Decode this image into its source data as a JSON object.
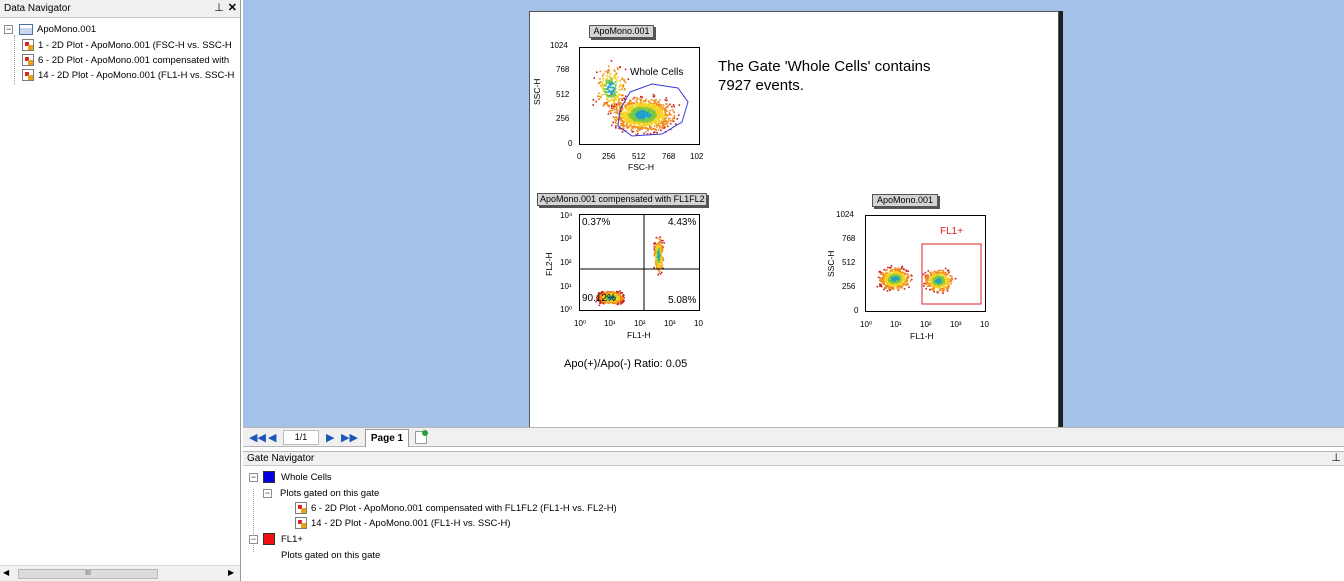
{
  "data_navigator": {
    "title": "Data Navigator",
    "pin_icon": "pin-icon",
    "close_icon": "close-icon",
    "root": {
      "label": "ApoMono.001",
      "expander": "−"
    },
    "items": [
      {
        "label": "1 - 2D Plot - ApoMono.001 (FSC-H vs. SSC-H"
      },
      {
        "label": "6 - 2D Plot - ApoMono.001 compensated with"
      },
      {
        "label": "14 - 2D Plot - ApoMono.001 (FL1-H vs. SSC-H"
      }
    ],
    "scroll_grip": "III"
  },
  "layout_page": {
    "gate_text_line1": "The Gate 'Whole Cells' contains",
    "gate_text_line2": "7927 events.",
    "ratio_text": "Apo(+)/Apo(-) Ratio: 0.05",
    "plot1": {
      "tag": "ApoMono.001",
      "xlabel": "FSC-H",
      "ylabel": "SSC-H",
      "xticks": [
        "0",
        "256",
        "512",
        "768",
        "102"
      ],
      "yticks": [
        "1024",
        "768",
        "512",
        "256",
        "0"
      ],
      "gate_label": "Whole Cells",
      "gate_color": "#3a3ad8"
    },
    "plot2": {
      "tag": "ApoMono.001 compensated with FL1FL2",
      "xlabel": "FL1-H",
      "ylabel": "FL2-H",
      "xticks": [
        "10⁰",
        "10¹",
        "10²",
        "10³",
        "10"
      ],
      "yticks": [
        "10⁴",
        "10³",
        "10²",
        "10¹",
        "10⁰"
      ],
      "quadrants": {
        "ul": "0.37%",
        "ur": "4.43%",
        "ll": "90.12%",
        "lr": "5.08%"
      }
    },
    "plot3": {
      "tag": "ApoMono.001",
      "xlabel": "FL1-H",
      "ylabel": "SSC-H",
      "xticks": [
        "10⁰",
        "10¹",
        "10²",
        "10³",
        "10"
      ],
      "yticks": [
        "1024",
        "768",
        "512",
        "256",
        "0"
      ],
      "gate_label": "FL1+",
      "gate_color": "#e02020"
    }
  },
  "page_nav": {
    "page_value": "1/1",
    "page_tab": "Page 1",
    "first_icon": "first-page-icon",
    "prev_icon": "prev-page-icon",
    "next_icon": "next-page-icon",
    "last_icon": "last-page-icon"
  },
  "gate_navigator": {
    "title": "Gate Navigator",
    "gates": [
      {
        "name": "Whole Cells",
        "color": "#0000e0",
        "sub": "Plots gated on this gate",
        "plots": [
          "6 - 2D Plot - ApoMono.001 compensated with FL1FL2 (FL1-H vs. FL2-H)",
          "14 - 2D Plot - ApoMono.001 (FL1-H vs. SSC-H)"
        ]
      },
      {
        "name": "FL1+",
        "color": "#f01010",
        "sub": "Plots gated on this gate",
        "plots": []
      }
    ]
  }
}
